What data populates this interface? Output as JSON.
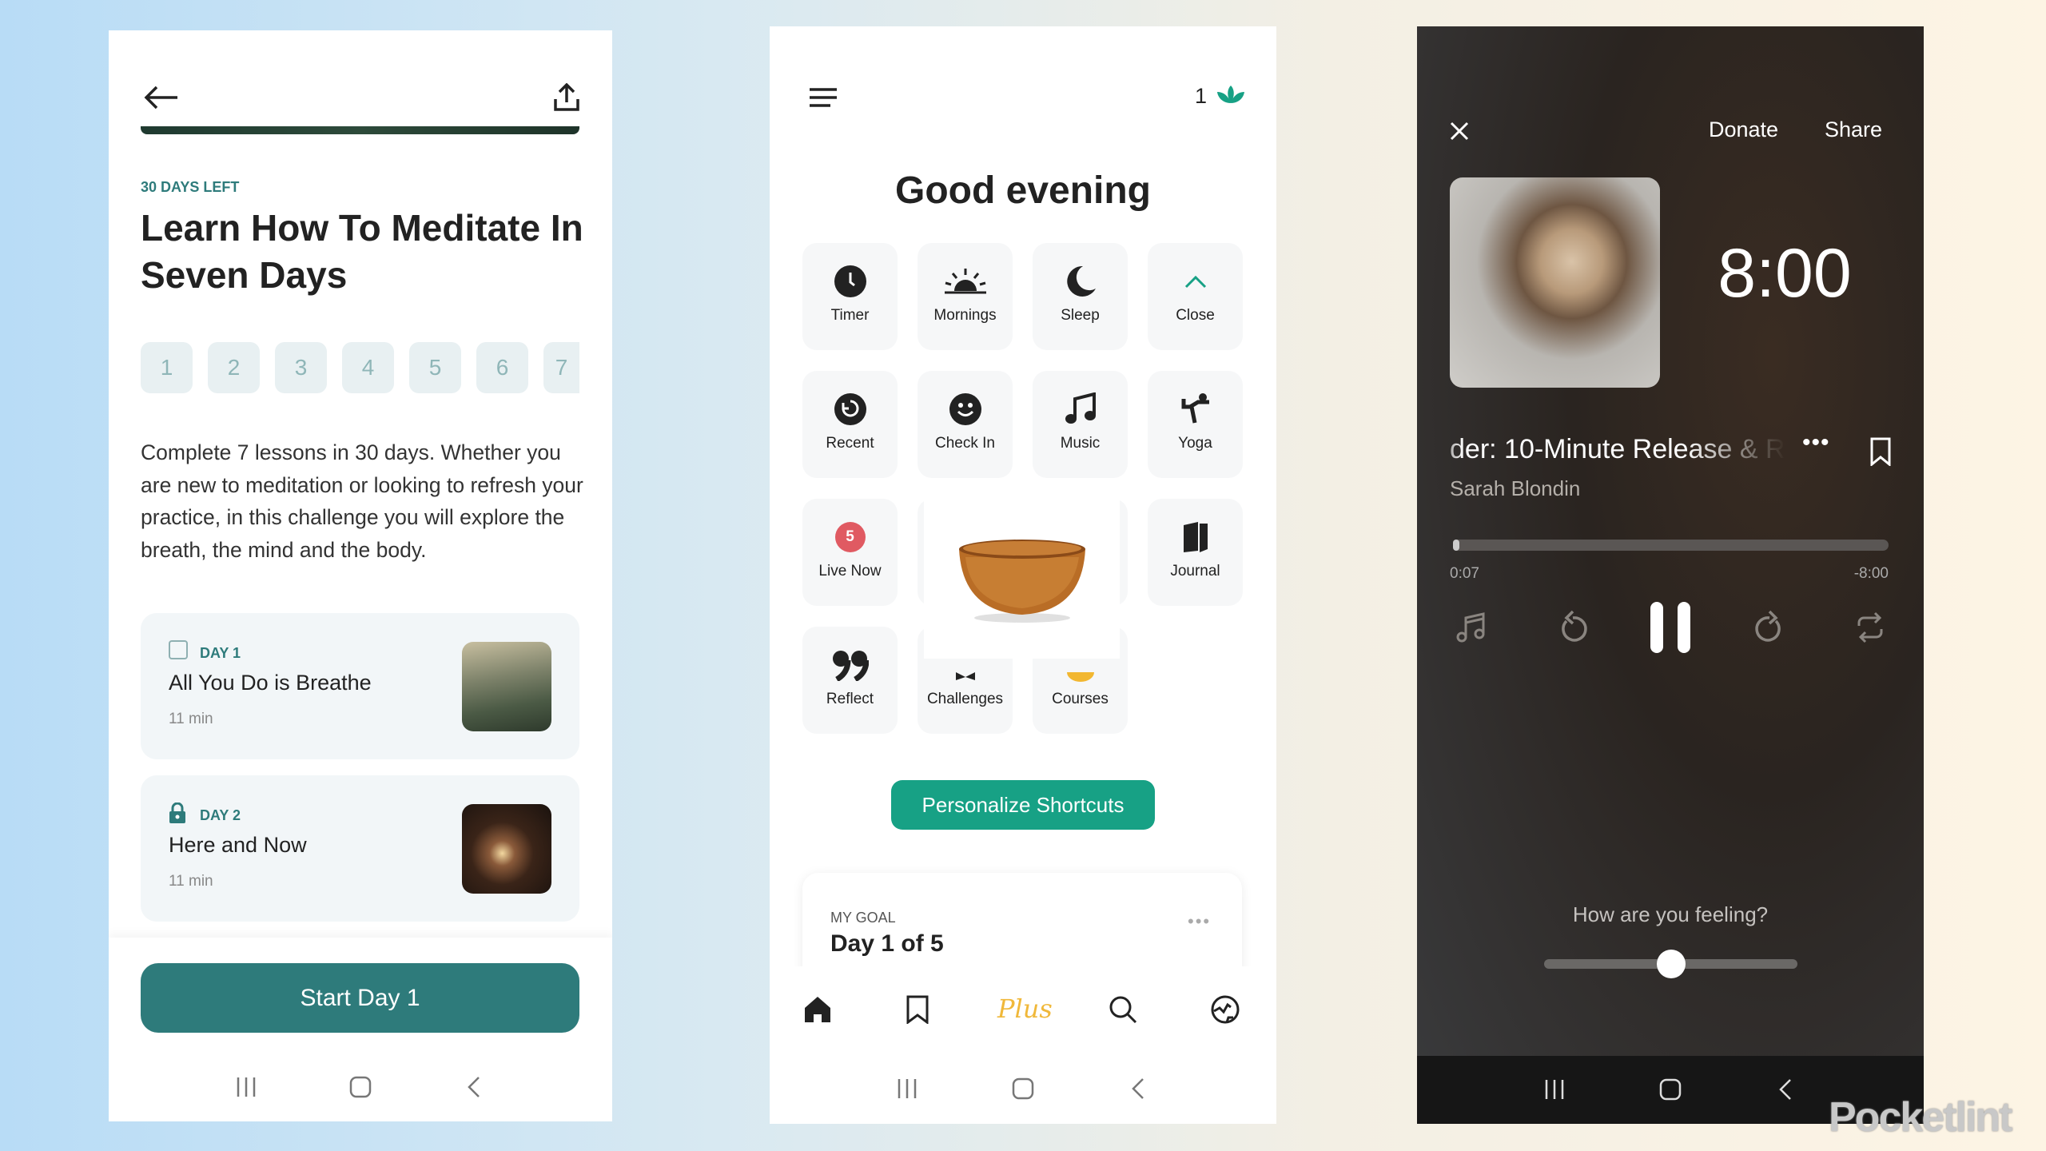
{
  "challenge": {
    "days_left": "30 DAYS LEFT",
    "title_line1": "Learn How To Meditate In",
    "title_line2": "Seven Days",
    "day_numbers": [
      "1",
      "2",
      "3",
      "4",
      "5",
      "6",
      "7"
    ],
    "description": "Complete 7 lessons in 30 days. Whether you are new to meditation or looking to refresh your practice, in this challenge you will explore the breath, the mind and the body.",
    "lessons": [
      {
        "day": "DAY 1",
        "title": "All You Do is Breathe",
        "duration": "11 min",
        "status": "unchecked"
      },
      {
        "day": "DAY 2",
        "title": "Here and Now",
        "duration": "11 min",
        "status": "locked"
      }
    ],
    "start_button": "Start Day 1",
    "accent": "#2e7b7b"
  },
  "home": {
    "streak_count": "1",
    "greeting": "Good evening",
    "shortcuts": [
      {
        "label": "Timer",
        "icon": "clock-icon"
      },
      {
        "label": "Mornings",
        "icon": "sunrise-icon"
      },
      {
        "label": "Sleep",
        "icon": "moon-icon"
      },
      {
        "label": "Close",
        "icon": "chevron-up-icon"
      },
      {
        "label": "Recent",
        "icon": "history-icon"
      },
      {
        "label": "Check In",
        "icon": "smiley-icon"
      },
      {
        "label": "Music",
        "icon": "music-note-icon"
      },
      {
        "label": "Yoga",
        "icon": "yoga-icon"
      },
      {
        "label": "Live Now",
        "icon": "live-badge-icon",
        "badge": "5"
      },
      {
        "label": "Journal",
        "icon": "journal-icon"
      },
      {
        "label": "Reflect",
        "icon": "quote-icon"
      },
      {
        "label": "Challenges",
        "icon": "challenges-icon"
      },
      {
        "label": "Courses",
        "icon": "courses-icon"
      }
    ],
    "personalize_button": "Personalize Shortcuts",
    "goal_label": "MY GOAL",
    "goal_value": "Day 1 of 5",
    "tabs": [
      "home-icon",
      "bookmark-icon",
      "Plus",
      "search-icon",
      "globe-icon"
    ],
    "accent": "#17a185",
    "plus_color": "#f0b83a"
  },
  "player": {
    "donate": "Donate",
    "share": "Share",
    "timer": "8:00",
    "track_title": "der: 10-Minute Release & R",
    "artist": "Sarah Blondin",
    "elapsed": "0:07",
    "remaining": "-8:00",
    "progress_fraction": 0.015,
    "feeling_prompt": "How are you feeling?",
    "feeling_slider": 0.5
  },
  "watermark": "Pocketlint"
}
